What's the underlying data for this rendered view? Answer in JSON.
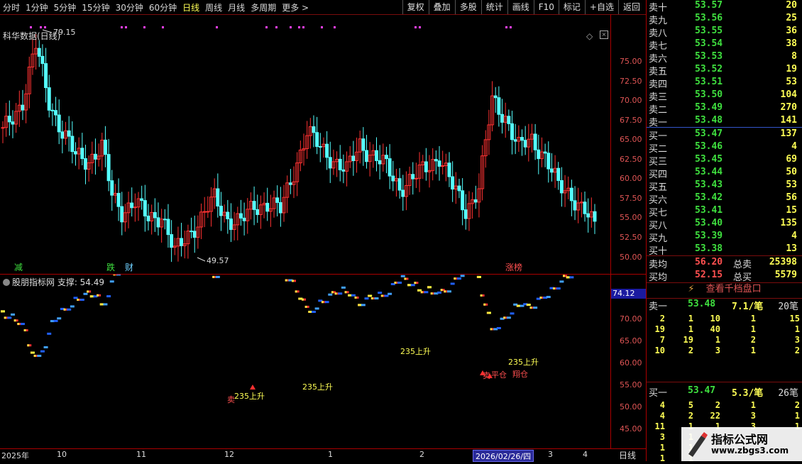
{
  "toolbar": {
    "periods": [
      "分时",
      "1分钟",
      "5分钟",
      "15分钟",
      "30分钟",
      "60分钟",
      "日线",
      "周线",
      "月线",
      "多周期",
      "更多 >"
    ],
    "active_period": "日线",
    "tools": [
      "复权",
      "叠加",
      "多股",
      "统计",
      "画线",
      "F10",
      "标记",
      "+自选",
      "返回"
    ]
  },
  "main": {
    "title": "科华数据(日线)",
    "high_label": "79.15",
    "low_label": "49.57",
    "y_ticks": [
      "75.00",
      "72.50",
      "70.00",
      "67.50",
      "65.00",
      "62.50",
      "60.00",
      "57.50",
      "55.00",
      "52.50",
      "50.00"
    ],
    "markers": [
      {
        "text": "减",
        "color": "#3fe03f"
      },
      {
        "text": "跌",
        "color": "#3fe03f"
      },
      {
        "text": "财",
        "color": "#6fd0ff"
      },
      {
        "text": "涨榜",
        "color": "#ff5050"
      }
    ]
  },
  "sub": {
    "title": "股朋指标网 支撑: 54.49",
    "y_ticks": [
      "70.00",
      "65.00",
      "60.00",
      "55.00",
      "50.00",
      "45.00"
    ],
    "current_value": "74.12",
    "labels": [
      "235上升",
      "235上升",
      "235上升",
      "235上升",
      "卖",
      "卖",
      "平仓",
      "翔仓"
    ]
  },
  "date_axis": {
    "labels": [
      "2025年",
      "10",
      "11",
      "12",
      "1",
      "2",
      "3",
      "4"
    ],
    "cursor_date": "2026/02/26/四",
    "period": "日线"
  },
  "book": {
    "sell": [
      {
        "label": "卖十",
        "price": "53.57",
        "vol": "20"
      },
      {
        "label": "卖九",
        "price": "53.56",
        "vol": "25"
      },
      {
        "label": "卖八",
        "price": "53.55",
        "vol": "36"
      },
      {
        "label": "卖七",
        "price": "53.54",
        "vol": "38"
      },
      {
        "label": "卖六",
        "price": "53.53",
        "vol": "8"
      },
      {
        "label": "卖五",
        "price": "53.52",
        "vol": "19"
      },
      {
        "label": "卖四",
        "price": "53.51",
        "vol": "53"
      },
      {
        "label": "卖三",
        "price": "53.50",
        "vol": "104"
      },
      {
        "label": "卖二",
        "price": "53.49",
        "vol": "270"
      },
      {
        "label": "卖一",
        "price": "53.48",
        "vol": "141"
      }
    ],
    "buy": [
      {
        "label": "买一",
        "price": "53.47",
        "vol": "137"
      },
      {
        "label": "买二",
        "price": "53.46",
        "vol": "4"
      },
      {
        "label": "买三",
        "price": "53.45",
        "vol": "69"
      },
      {
        "label": "买四",
        "price": "53.44",
        "vol": "50"
      },
      {
        "label": "买五",
        "price": "53.43",
        "vol": "53"
      },
      {
        "label": "买六",
        "price": "53.42",
        "vol": "56"
      },
      {
        "label": "买七",
        "price": "53.41",
        "vol": "15"
      },
      {
        "label": "买八",
        "price": "53.40",
        "vol": "135"
      },
      {
        "label": "买九",
        "price": "53.39",
        "vol": "4"
      },
      {
        "label": "买十",
        "price": "53.38",
        "vol": "13"
      }
    ],
    "avg_sell": {
      "label": "卖均",
      "price": "56.20",
      "total_label": "总卖",
      "total": "25398"
    },
    "avg_buy": {
      "label": "买均",
      "price": "52.15",
      "total_label": "总买",
      "total": "5579"
    },
    "qiandang": "查看千档盘口",
    "sell1_detail": {
      "label": "卖一",
      "price": "53.48",
      "avg": "7.1/笔",
      "count": "20笔"
    },
    "sell_queue": [
      [
        "2",
        "1",
        "10",
        "1",
        "15"
      ],
      [
        "19",
        "1",
        "40",
        "1",
        "1"
      ],
      [
        "7",
        "19",
        "1",
        "2",
        "3"
      ],
      [
        "10",
        "2",
        "3",
        "1",
        "2"
      ]
    ],
    "buy1_detail": {
      "label": "买一",
      "price": "53.47",
      "avg": "5.3/笔",
      "count": "26笔"
    },
    "buy_queue": [
      [
        "4",
        "5",
        "2",
        "1",
        "2"
      ],
      [
        "4",
        "2",
        "22",
        "3",
        "1"
      ],
      [
        "11",
        "1",
        "1",
        "3",
        "1"
      ],
      [
        "3",
        "1",
        "",
        "",
        ""
      ],
      [
        "1",
        "1",
        "",
        "",
        ""
      ],
      [
        "1",
        "1",
        "",
        "",
        ""
      ]
    ]
  },
  "watermark": {
    "title": "指标公式网",
    "url": "www.zbgs3.com"
  },
  "colors": {
    "up": "#ff3232",
    "down": "#54ffff",
    "grid": "#a00000",
    "support_line": "#ffffff"
  }
}
